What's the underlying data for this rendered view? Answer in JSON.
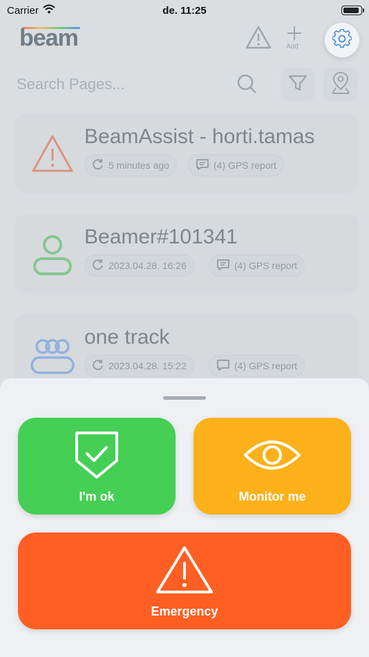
{
  "status_bar": {
    "carrier": "Carrier",
    "time": "de. 11:25"
  },
  "header": {
    "logo": "beam",
    "add_label": "Add"
  },
  "search": {
    "placeholder": "Search Pages..."
  },
  "cards": [
    {
      "title": "BeamAssist - horti.tamas",
      "icon": "warning-triangle-icon",
      "time_chip": "5 minutes ago",
      "report_chip": "(4) GPS report",
      "accent": "#ff6a3d"
    },
    {
      "title": "Beamer#101341",
      "icon": "person-icon",
      "time_chip": "2023.04.28. 16:26",
      "report_chip": "(4) GPS report",
      "accent": "#45cf55"
    },
    {
      "title": "one track",
      "icon": "group-icon",
      "time_chip": "2023.04.28. 15:22",
      "report_chip": "(4) GPS report",
      "accent": "#3a8dff"
    }
  ],
  "sheet": {
    "ok_label": "I'm ok",
    "monitor_label": "Monitor me",
    "emergency_label": "Emergency"
  },
  "colors": {
    "ok": "#45cf55",
    "monitor": "#fcb11a",
    "emergency": "#ff5f22"
  }
}
